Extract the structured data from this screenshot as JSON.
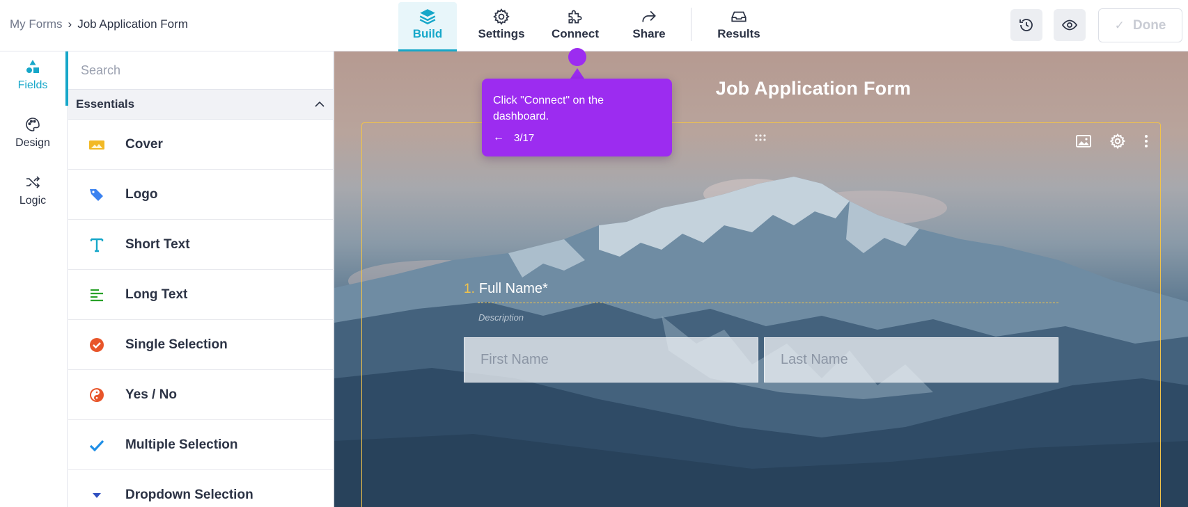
{
  "breadcrumb": {
    "parent": "My Forms",
    "separator": "›",
    "current": "Job Application Form"
  },
  "tabs": [
    {
      "label": "Build",
      "icon": "layers-icon",
      "active": true
    },
    {
      "label": "Settings",
      "icon": "gear-icon",
      "active": false
    },
    {
      "label": "Connect",
      "icon": "puzzle-icon",
      "active": false
    },
    {
      "label": "Share",
      "icon": "share-arrow-icon",
      "active": false
    },
    {
      "label": "Results",
      "icon": "inbox-icon",
      "active": false
    }
  ],
  "toolbar": {
    "history_icon": "history-icon",
    "preview_icon": "eye-icon",
    "done_label": "Done"
  },
  "rail": [
    {
      "label": "Fields",
      "icon": "shapes-icon",
      "active": true
    },
    {
      "label": "Design",
      "icon": "palette-icon",
      "active": false
    },
    {
      "label": "Logic",
      "icon": "shuffle-icon",
      "active": false
    }
  ],
  "panel": {
    "search_placeholder": "Search",
    "section": "Essentials",
    "fields": [
      {
        "label": "Cover",
        "icon": "cover-image-icon",
        "color": "#f2b925"
      },
      {
        "label": "Logo",
        "icon": "tag-icon",
        "color": "#3b82f0"
      },
      {
        "label": "Short Text",
        "icon": "text-t-icon",
        "color": "#16a7c9"
      },
      {
        "label": "Long Text",
        "icon": "paragraph-lines-icon",
        "color": "#2aa22a"
      },
      {
        "label": "Single Selection",
        "icon": "check-circle-icon",
        "color": "#e8552a"
      },
      {
        "label": "Yes / No",
        "icon": "yin-yang-icon",
        "color": "#e8552a"
      },
      {
        "label": "Multiple Selection",
        "icon": "checkmark-icon",
        "color": "#1e8ee6"
      },
      {
        "label": "Dropdown Selection",
        "icon": "caret-down-icon",
        "color": "#2f4fc0"
      }
    ]
  },
  "form": {
    "title": "Job Application Form",
    "question_number": "1.",
    "question_label": "Full Name*",
    "question_description": "Description",
    "first_name_placeholder": "First Name",
    "last_name_placeholder": "Last Name"
  },
  "tooltip": {
    "text": "Click \"Connect\" on the dashboard.",
    "step": "3/17"
  },
  "colors": {
    "accent": "#16a7c9",
    "tooltip": "#9c2cf0",
    "card_border": "#f2c34a"
  }
}
